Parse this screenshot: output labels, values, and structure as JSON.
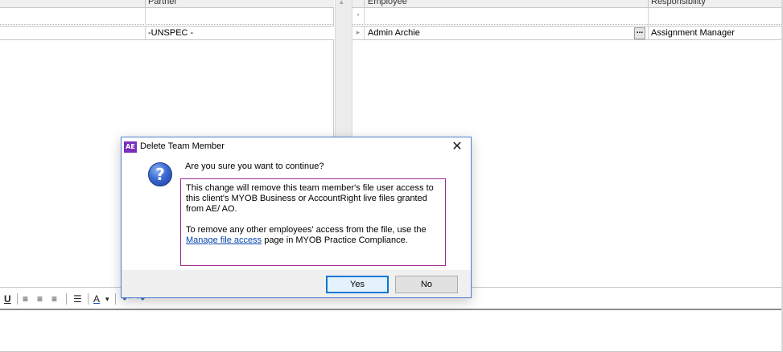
{
  "left_grid": {
    "column_header": "Partner",
    "rows": [
      {
        "partner": "-UNSPEC -"
      }
    ]
  },
  "splitter": {
    "glyph": "▴"
  },
  "right_grid": {
    "columns": {
      "employee": "Employee",
      "responsibility": "Responsibility"
    },
    "new_row_marker": "*",
    "row_marker": "▸",
    "rows": [
      {
        "employee": "Admin Archie",
        "lookup_button": "...",
        "responsibility": "Assignment Manager"
      }
    ]
  },
  "toolbar": {
    "underline": "U",
    "align_left": "≡",
    "align_center": "≡",
    "align_right": "≡",
    "bullets": "☰",
    "font_color": "A",
    "dropdown": "▾",
    "undo": "↶",
    "redo": "↷"
  },
  "dialog": {
    "app_icon": "AE",
    "title": "Delete Team Member",
    "close": "✕",
    "question_icon": "?",
    "question": "Are you sure you want to continue?",
    "message_1": "This change will remove this team member's file user access to this client's MYOB Business or AccountRight live files granted from AE/ AO.",
    "message_2_prefix": "To remove any other employees' access from the file, use the",
    "link_text": "Manage file access",
    "message_2_suffix": " page in MYOB Practice Compliance.",
    "yes_label": "Yes",
    "no_label": "No"
  }
}
